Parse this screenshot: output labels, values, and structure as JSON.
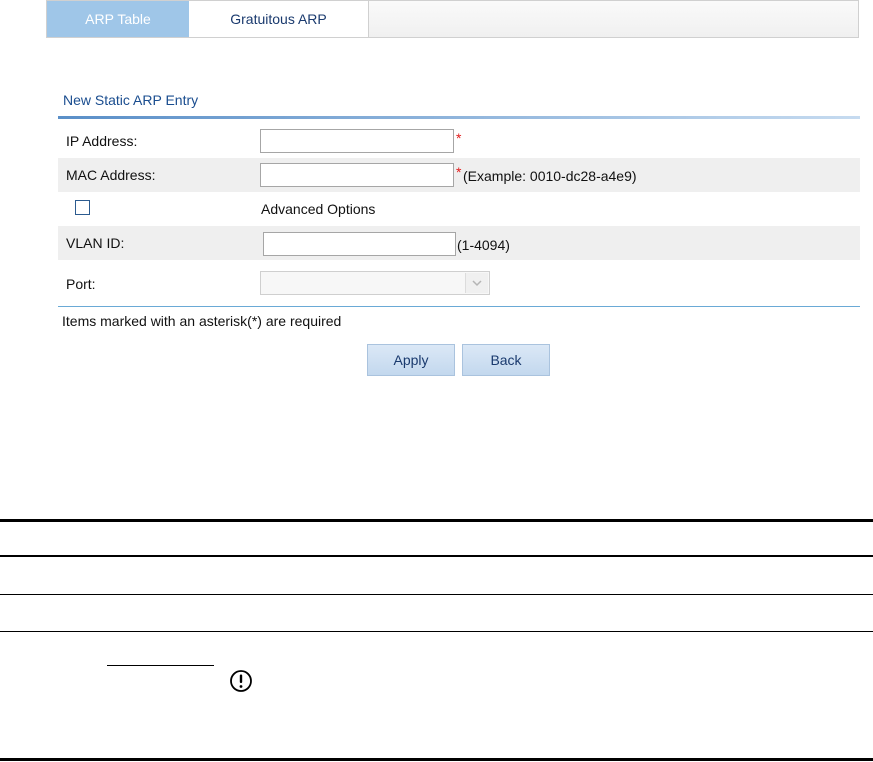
{
  "tabs": [
    {
      "label": "ARP Table",
      "active": true
    },
    {
      "label": "Gratuitous ARP",
      "active": false
    }
  ],
  "form": {
    "title": "New Static ARP Entry",
    "ip_address": {
      "label": "IP Address:",
      "value": "",
      "required": "*"
    },
    "mac_address": {
      "label": "MAC Address:",
      "value": "",
      "required": "*",
      "hint": "(Example: 0010-dc28-a4e9)"
    },
    "advanced": {
      "label": "Advanced Options",
      "checked": false
    },
    "vlan_id": {
      "label": "VLAN ID:",
      "value": "",
      "hint": "(1-4094)"
    },
    "port": {
      "label": "Port:",
      "selected": ""
    },
    "required_note": "Items marked with an asterisk(*) are required"
  },
  "buttons": {
    "apply": "Apply",
    "back": "Back"
  },
  "colors": {
    "tab_active": "#9fc6e8",
    "title": "#1a4d8f",
    "required": "#e21b1b",
    "button": "#c3d8ee"
  },
  "icons": {
    "warning": "exclamation-circle-icon"
  }
}
